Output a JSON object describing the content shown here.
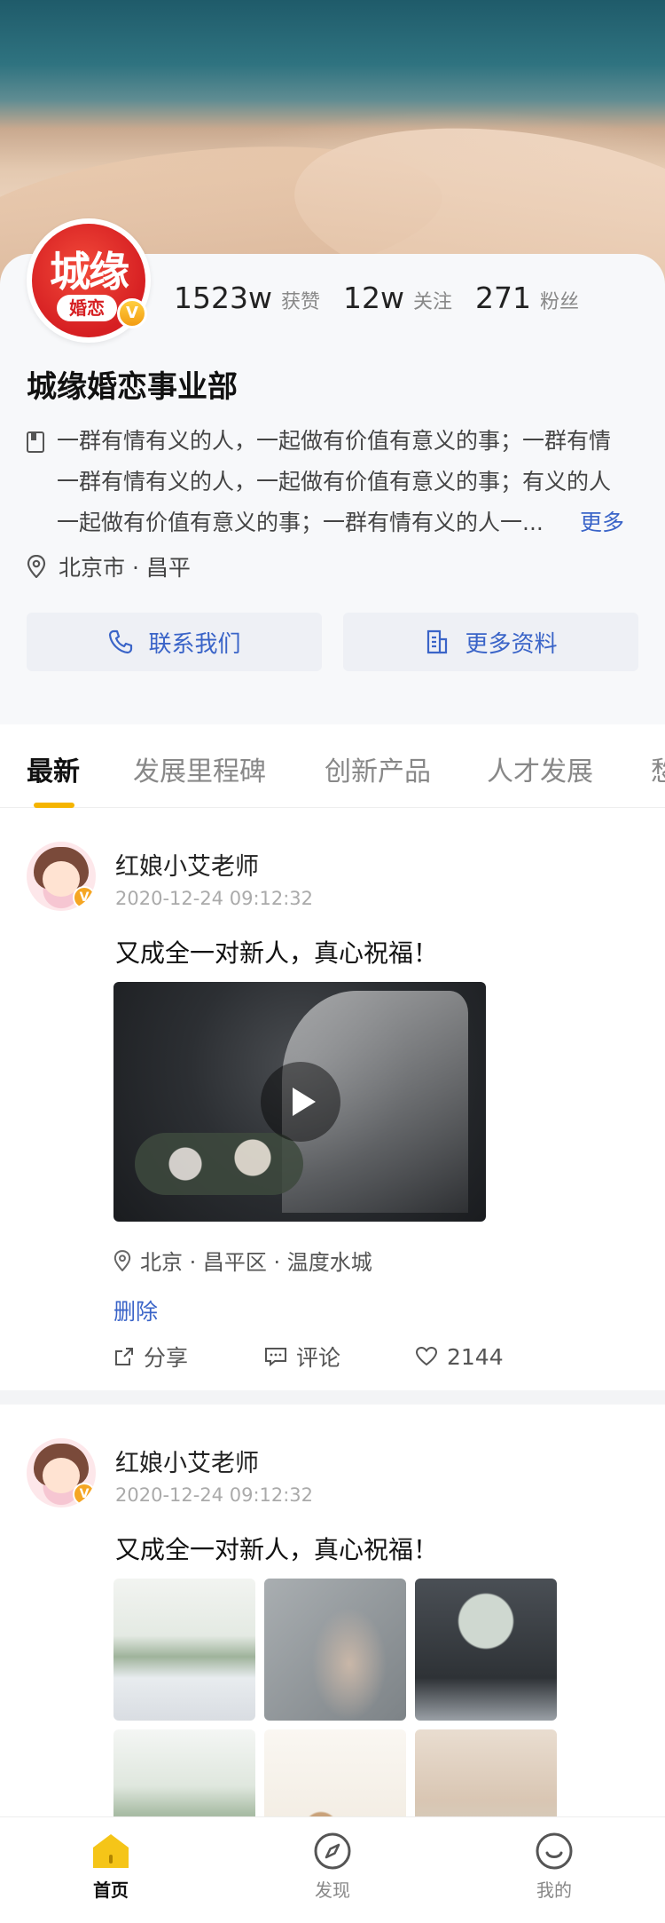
{
  "profile": {
    "logo_main": "城缘",
    "logo_sub": "婚恋",
    "verified_mark": "V",
    "stats": [
      {
        "num": "1523w",
        "label": "获赞"
      },
      {
        "num": "12w",
        "label": "关注"
      },
      {
        "num": "271",
        "label": "粉丝"
      }
    ],
    "name": "城缘婚恋事业部",
    "description_lines": [
      "一群有情有义的人，一起做有价值有意义的事；一群有情",
      "一群有情有义的人，一起做有价值有意义的事；有义的人",
      "一起做有价值有意义的事；一群有情有义的人一..."
    ],
    "more_label": "更多",
    "location": "北京市 · 昌平",
    "buttons": {
      "contact": "联系我们",
      "more_info": "更多资料"
    }
  },
  "tabs": [
    "最新",
    "发展里程碑",
    "创新产品",
    "人才发展",
    "愁"
  ],
  "posts": [
    {
      "author": "红娘小艾老师",
      "time": "2020-12-24  09:12:32",
      "text": "又成全一对新人，真心祝福！",
      "location": "北京 · 昌平区 · 温度水城",
      "delete_label": "删除",
      "share_label": "分享",
      "comment_label": "评论",
      "likes": "2144"
    },
    {
      "author": "红娘小艾老师",
      "time": "2020-12-24  09:12:32",
      "text": "又成全一对新人，真心祝福！"
    }
  ],
  "nav": [
    {
      "label": "首页",
      "icon": "home-icon",
      "active": true
    },
    {
      "label": "发现",
      "icon": "compass-icon",
      "active": false
    },
    {
      "label": "我的",
      "icon": "smile-icon",
      "active": false
    }
  ],
  "colors": {
    "accent_blue": "#3a64c8",
    "accent_yellow": "#f5b400",
    "brand_red": "#d61f22"
  }
}
